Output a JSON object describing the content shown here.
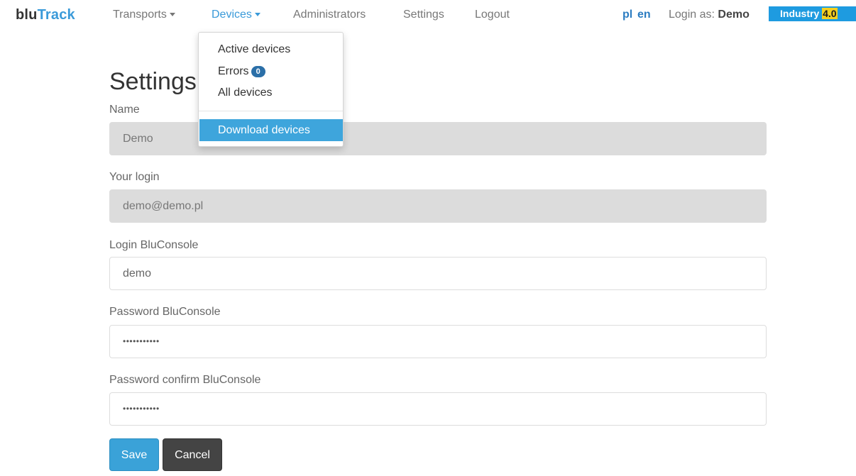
{
  "brand": {
    "part1": "blu",
    "part2": "Track"
  },
  "nav": {
    "transports": "Transports",
    "devices": "Devices",
    "administrators": "Administrators",
    "settings": "Settings",
    "logout": "Logout"
  },
  "lang": {
    "pl": "pl",
    "en": "en"
  },
  "login_as": {
    "label": "Login as:",
    "user": "Demo"
  },
  "industry_badge": {
    "text": "Industry",
    "version": "4.0"
  },
  "devices_menu": {
    "items": [
      "Active devices",
      "Errors",
      "All devices"
    ],
    "errors_count": "0",
    "download": "Download devices"
  },
  "page": {
    "title": "Settings",
    "fields": [
      {
        "label": "Name",
        "value": "Demo"
      },
      {
        "label": "Your login",
        "value": "demo@demo.pl"
      },
      {
        "label": "Login BluConsole",
        "value": "demo"
      },
      {
        "label": "Password BluConsole",
        "value": "•••••••••••"
      },
      {
        "label": "Password confirm BluConsole",
        "value": "•••••••••••"
      }
    ],
    "save_label": "Save",
    "cancel_label": "Cancel"
  },
  "colors": {
    "accent": "#3a9ad9",
    "industry_bg": "#1e9be0",
    "industry_version_bg": "#f5d020",
    "cancel_bg": "#444444",
    "readonly_bg": "#dcdcdc"
  }
}
